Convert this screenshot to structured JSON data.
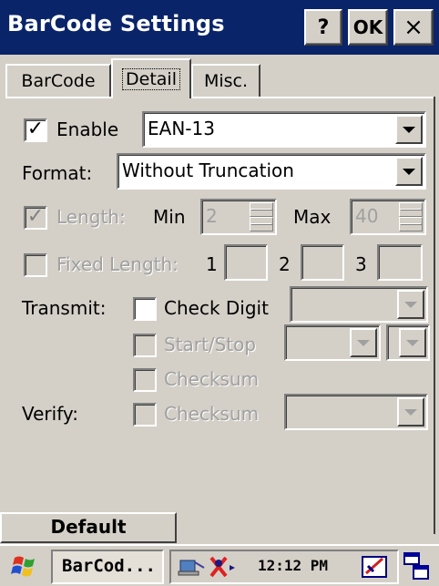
{
  "window": {
    "title": "BarCode Settings",
    "help_label": "?",
    "ok_label": "OK",
    "close_label": "×"
  },
  "tabs": [
    {
      "label": "BarCode",
      "active": false
    },
    {
      "label": "Detail",
      "active": true
    },
    {
      "label": "Misc.",
      "active": false
    }
  ],
  "enable": {
    "label": "Enable",
    "checked": true,
    "symbology": "EAN-13"
  },
  "format": {
    "label": "Format:",
    "value": "Without Truncation"
  },
  "length": {
    "label": "Length:",
    "checked": true,
    "min_label": "Min",
    "min_value": "2",
    "max_label": "Max",
    "max_value": "40"
  },
  "fixed_length": {
    "label": "Fixed Length:",
    "checked": false,
    "n1": "1",
    "n2": "2",
    "n3": "3",
    "v1": "",
    "v2": "",
    "v3": ""
  },
  "transmit": {
    "label": "Transmit:",
    "check_digit": {
      "label": "Check Digit",
      "checked": false,
      "value": ""
    },
    "start_stop": {
      "label": "Start/Stop",
      "checked": false,
      "value1": "",
      "value2": ""
    },
    "checksum": {
      "label": "Checksum",
      "checked": false
    }
  },
  "verify": {
    "label": "Verify:",
    "checksum": {
      "label": "Checksum",
      "checked": false,
      "value": ""
    }
  },
  "default_button": "Default",
  "taskbar": {
    "task_label": "BarCod...",
    "time": "12:12 PM"
  },
  "colors": {
    "titlebar": "#0a246a",
    "face": "#d4d0c8",
    "disabled_text": "#a0a0a0"
  }
}
